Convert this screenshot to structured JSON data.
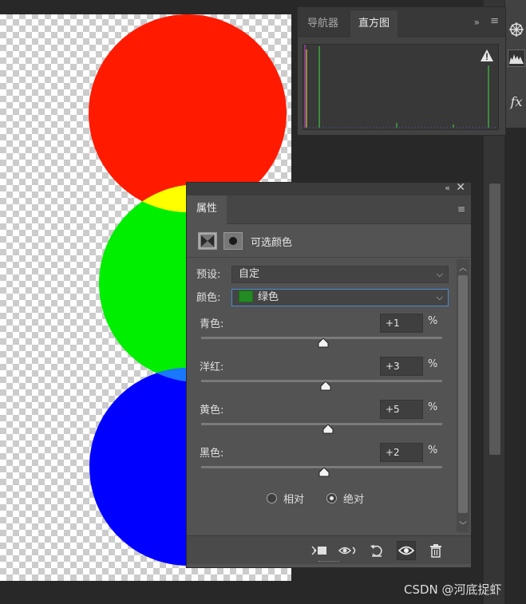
{
  "histogram_panel": {
    "tabs": [
      {
        "label": "导航器",
        "active": false
      },
      {
        "label": "直方图",
        "active": true
      }
    ],
    "expand_glyph": "»",
    "menu_glyph": "≡"
  },
  "properties_panel": {
    "collapse_glyph": "«",
    "close_glyph": "✕",
    "tab_label": "属性",
    "menu_glyph": "≡",
    "adjustment_title": "可选颜色",
    "preset_label": "预设:",
    "preset_value": "自定",
    "color_label": "颜色:",
    "color_value": "绿色",
    "color_swatch": "#228b22",
    "sliders": [
      {
        "label": "青色:",
        "value": "+1",
        "unit": "%",
        "percent": 1
      },
      {
        "label": "洋红:",
        "value": "+3",
        "unit": "%",
        "percent": 3
      },
      {
        "label": "黄色:",
        "value": "+5",
        "unit": "%",
        "percent": 5
      },
      {
        "label": "黑色:",
        "value": "+2",
        "unit": "%",
        "percent": 2
      }
    ],
    "method_options": [
      {
        "label": "相对",
        "selected": false
      },
      {
        "label": "绝对",
        "selected": true
      }
    ],
    "caret_glyph": "⌵"
  },
  "toolbar_icons": [
    "color-wheel-icon",
    "histogram-icon",
    "fx-icon"
  ],
  "fx_label": "fx",
  "colors": {
    "red": "#ff1a00",
    "yellow": "#ffff00",
    "green": "#00ee00",
    "blue": "#0000ff",
    "light_blue": "#1a78ff"
  },
  "watermark": "CSDN @河底捉虾"
}
